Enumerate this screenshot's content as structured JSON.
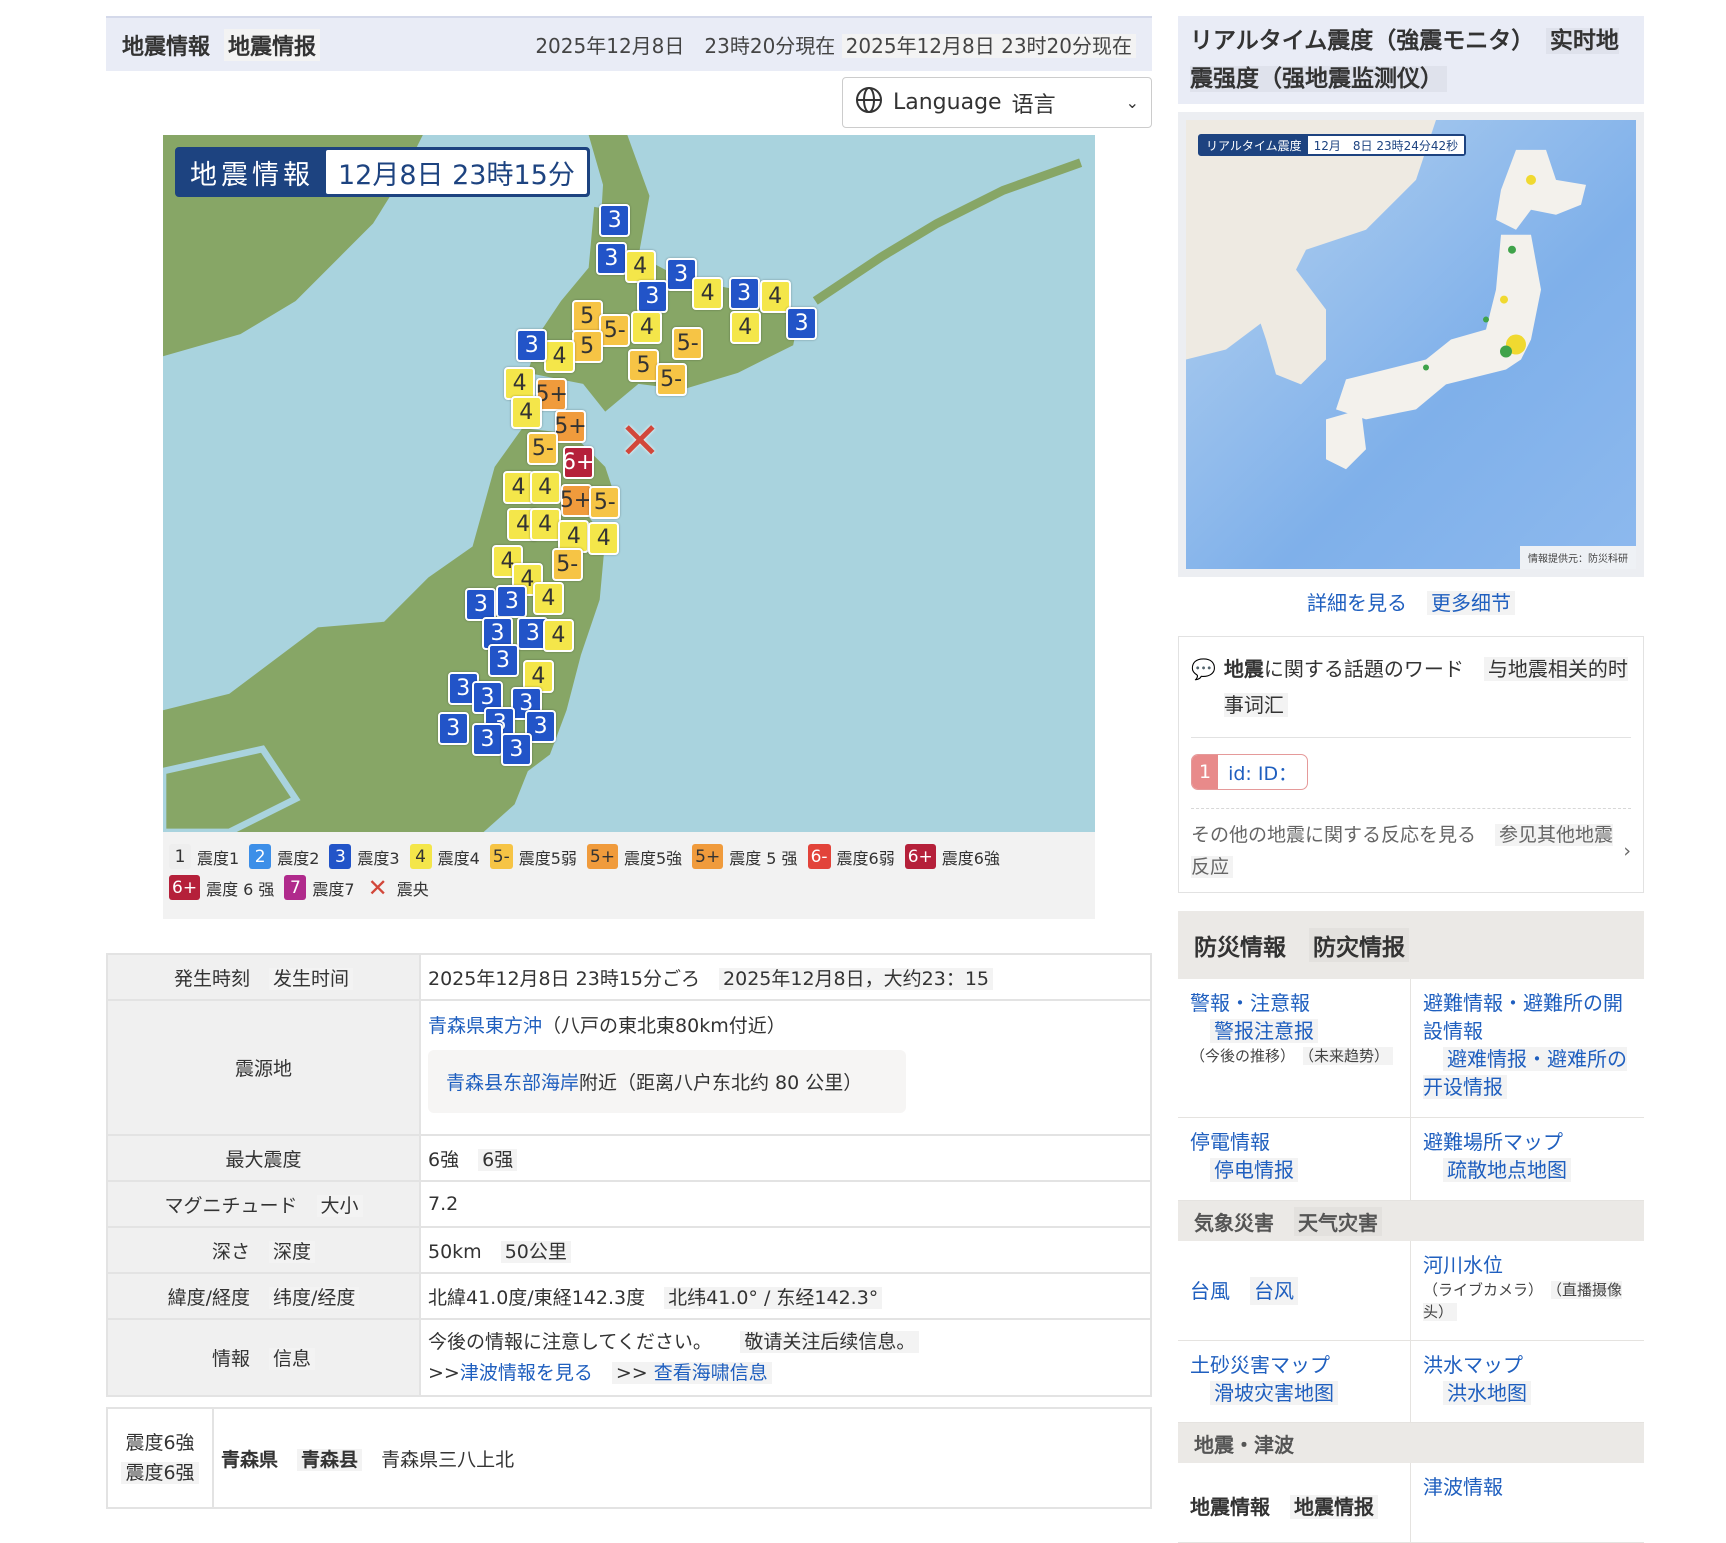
{
  "header": {
    "title_ja": "地震情報",
    "title_zh": "地震情报",
    "time_ja": "2025年12月8日　23時20分現在",
    "time_zh": "2025年12月8日 23时20分现在"
  },
  "language": {
    "label": "Language",
    "label_zh": "语言"
  },
  "map": {
    "title": "地震情報",
    "time": "12月8日 23時15分",
    "epicenter_symbol": "✕",
    "markers": [
      "3",
      "3",
      "4",
      "3",
      "3",
      "4",
      "3",
      "4",
      "3",
      "4",
      "5",
      "5-",
      "4",
      "5-",
      "5",
      "4",
      "3",
      "5",
      "5-",
      "4",
      "5+",
      "4",
      "5+",
      "5-",
      "6+",
      "4",
      "4",
      "5+",
      "5-",
      "4",
      "4",
      "4",
      "4",
      "4",
      "5-",
      "4",
      "3",
      "3",
      "4",
      "3",
      "3",
      "4",
      "3",
      "4",
      "3",
      "3",
      "3",
      "3",
      "3",
      "3",
      "3",
      "3"
    ]
  },
  "legend": [
    {
      "badge": "1",
      "label": "震度1",
      "color": "#eeeeee",
      "text": "#333"
    },
    {
      "badge": "2",
      "label": "震度2",
      "color": "#3d8fe8",
      "text": "#fff"
    },
    {
      "badge": "3",
      "label": "震度3",
      "color": "#2254c8",
      "text": "#fff"
    },
    {
      "badge": "4",
      "label": "震度4",
      "color": "#f4e64a",
      "text": "#333"
    },
    {
      "badge": "5-",
      "label": "震度5弱",
      "color": "#f6c445",
      "text": "#333"
    },
    {
      "badge": "5+",
      "label": "震度5強",
      "color": "#f09b3c",
      "text": "#333"
    },
    {
      "badge": "5+",
      "label": "震度 5 强",
      "color": "#f09b3c",
      "text": "#333"
    },
    {
      "badge": "6-",
      "label": "震度6弱",
      "color": "#e2433a",
      "text": "#fff"
    },
    {
      "badge": "6+",
      "label": "震度6強",
      "color": "#b5203a",
      "text": "#fff"
    },
    {
      "badge": "6+",
      "label": "震度 6 强",
      "color": "#b5203a",
      "text": "#fff"
    },
    {
      "badge": "7",
      "label": "震度7",
      "color": "#b02a8c",
      "text": "#fff"
    },
    {
      "badge": "✕",
      "label": "震央",
      "color": "transparent",
      "text": "#d2473a"
    }
  ],
  "details": {
    "time_label": "発生時刻",
    "time_label_zh": "发生时间",
    "time_value": "2025年12月8日 23時15分ごろ",
    "time_value_zh": "2025年12月8日，大约23：15",
    "epicenter_label": "震源地",
    "epicenter_link": "青森県東方沖",
    "epicenter_note": "（八戸の東北東80km付近）",
    "epicenter_zh_link": "青森县东部海岸",
    "epicenter_zh_rest": "附近（距离八户东北约 80 公里）",
    "max_label": "最大震度",
    "max_value": "6強",
    "max_value_zh": "6强",
    "mag_label": "マグニチュード",
    "mag_label_zh": "大小",
    "mag_value": "7.2",
    "depth_label": "深さ",
    "depth_label_zh": "深度",
    "depth_value": "50km",
    "depth_value_zh": "50公里",
    "latlon_label": "緯度/経度",
    "latlon_label_zh": "纬度/经度",
    "latlon_value": "北緯41.0度/東経142.3度",
    "latlon_value_zh": "北纬41.0° / 东经142.3°",
    "info_label": "情報",
    "info_label_zh": "信息",
    "info_value": "今後の情報に注意してください。",
    "info_value_zh": "敬请关注后续信息。",
    "tsunami_link": "津波情報を見る",
    "tsunami_link_zh": "查看海啸信息",
    "arrow": ">>"
  },
  "intensity_table": {
    "level": "震度6強",
    "level_zh": "震度6强",
    "pref": "青森県",
    "pref_zh": "青森县",
    "places": "青森県三八上北"
  },
  "realtime": {
    "title": "リアルタイム震度（強震モニタ）",
    "title_zh": "实时地震强度（强地震监测仪）",
    "badge": "リアルタイム震度",
    "time": "12月　8日 23時24分42秒",
    "credit": "情報提供元：防災科研",
    "more": "詳細を見る",
    "more_zh": "更多细节"
  },
  "topics": {
    "title_bold": "地震",
    "title_rest": "に関する話題のワード",
    "title_zh": "与地震相关的时事词汇",
    "chip_num": "1",
    "chip_text": "id:  ID：",
    "more": "その他の地震に関する反応を見る",
    "more_zh": "参见其他地震反应"
  },
  "bosai": {
    "title": "防災情報",
    "title_zh": "防灾情报",
    "warn": "警報・注意報",
    "warn_zh": "警报注意报",
    "warn_sub": "（今後の推移）",
    "warn_sub_zh": "（未来趋势）",
    "evac": "避難情報・避難所の開設情報",
    "evac_zh": "避难情报・避难所の开设情报",
    "power": "停電情報",
    "power_zh": "停电情报",
    "shelter": "避難場所マップ",
    "shelter_zh": "疏散地点地图",
    "weather": "気象災害",
    "weather_zh": "天气灾害",
    "typhoon": "台風",
    "typhoon_zh": "台风",
    "river": "河川水位",
    "river_sub": "（ライブカメラ）",
    "river_sub_zh": "（直播摄像头）",
    "landslide": "土砂災害マップ",
    "landslide_zh": "滑坡灾害地图",
    "flood": "洪水マップ",
    "flood_zh": "洪水地图",
    "quake": "地震・津波",
    "quake_info": "地震情報",
    "quake_info_zh": "地震情报",
    "tsunami": "津波情報"
  }
}
